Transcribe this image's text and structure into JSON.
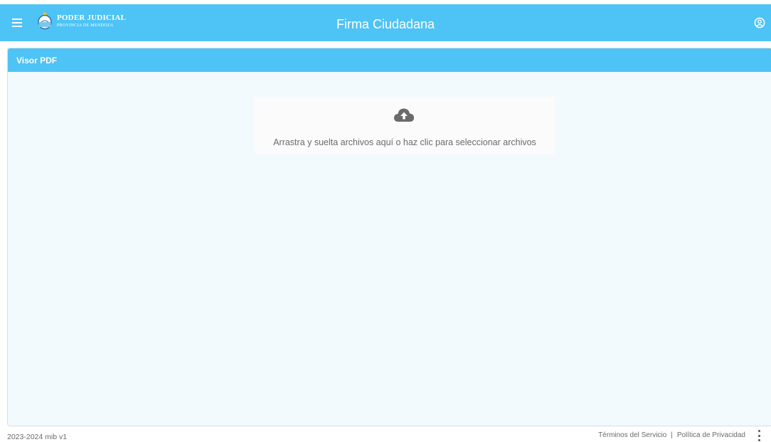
{
  "header": {
    "logo_title": "PODER JUDICIAL",
    "logo_subtitle": "PROVINCIA DE MENDOZA",
    "app_title": "Firma Ciudadana"
  },
  "viewer": {
    "title": "Visor PDF",
    "dropzone_text": "Arrastra y suelta archivos aquí o haz clic para seleccionar archivos",
    "icon": "cloud-upload-icon"
  },
  "footer": {
    "version": "2023-2024 mib v1",
    "terms": "Términos del Servicio",
    "separator": "|",
    "privacy": "Política de Privacidad"
  },
  "colors": {
    "accent": "#4ec3f5",
    "panel_bg": "#f2fafe",
    "icon_gray": "#6b6b6b"
  }
}
